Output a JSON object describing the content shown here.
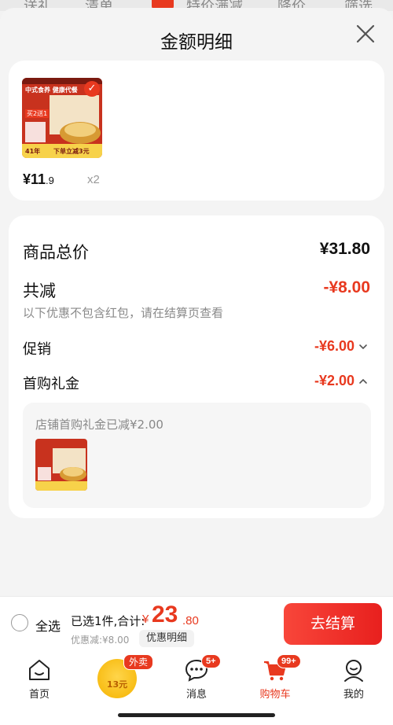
{
  "background_tabs": [
    "送礼",
    "清单",
    "",
    "特价满减",
    "降价",
    "筛选"
  ],
  "sheet": {
    "title": "金额明细"
  },
  "product": {
    "thumbnail": {
      "headline": "中式食养 健康代餐",
      "promo": "买2送1",
      "banner": "下单立减3元",
      "years": "41年"
    },
    "price_int": "¥11",
    "price_dec": ".9",
    "qty": "x2"
  },
  "summary": {
    "total_label": "商品总价",
    "total_value": "¥31.80",
    "reduce_label": "共减",
    "reduce_value": "-¥8.00",
    "note": "以下优惠不包含红包，请在结算页查看",
    "promo_label": "促销",
    "promo_value": "-¥6.00",
    "gift_label": "首购礼金",
    "gift_value": "-¥2.00",
    "gift_detail": "店铺首购礼金已减¥2.00"
  },
  "checkout": {
    "select_all": "全选",
    "selected_text": "已选1件,合计:",
    "currency": "¥",
    "total_int": "23",
    "total_dec": ".80",
    "discount_text": "优惠减:¥8.00",
    "discount_detail_btn": "优惠明细",
    "checkout_btn": "去结算"
  },
  "tabbar": {
    "tabs": [
      {
        "label": "首页",
        "icon": "home-icon"
      },
      {
        "label": "",
        "icon": "waimai-icon",
        "badge": "外卖",
        "amount": "13元"
      },
      {
        "label": "消息",
        "icon": "message-icon",
        "badge": "5+"
      },
      {
        "label": "购物车",
        "icon": "cart-icon",
        "badge": "99+"
      },
      {
        "label": "我的",
        "icon": "profile-icon"
      }
    ]
  },
  "colors": {
    "accent": "#e8391f",
    "text": "#111111",
    "muted": "#8a8a8a"
  }
}
